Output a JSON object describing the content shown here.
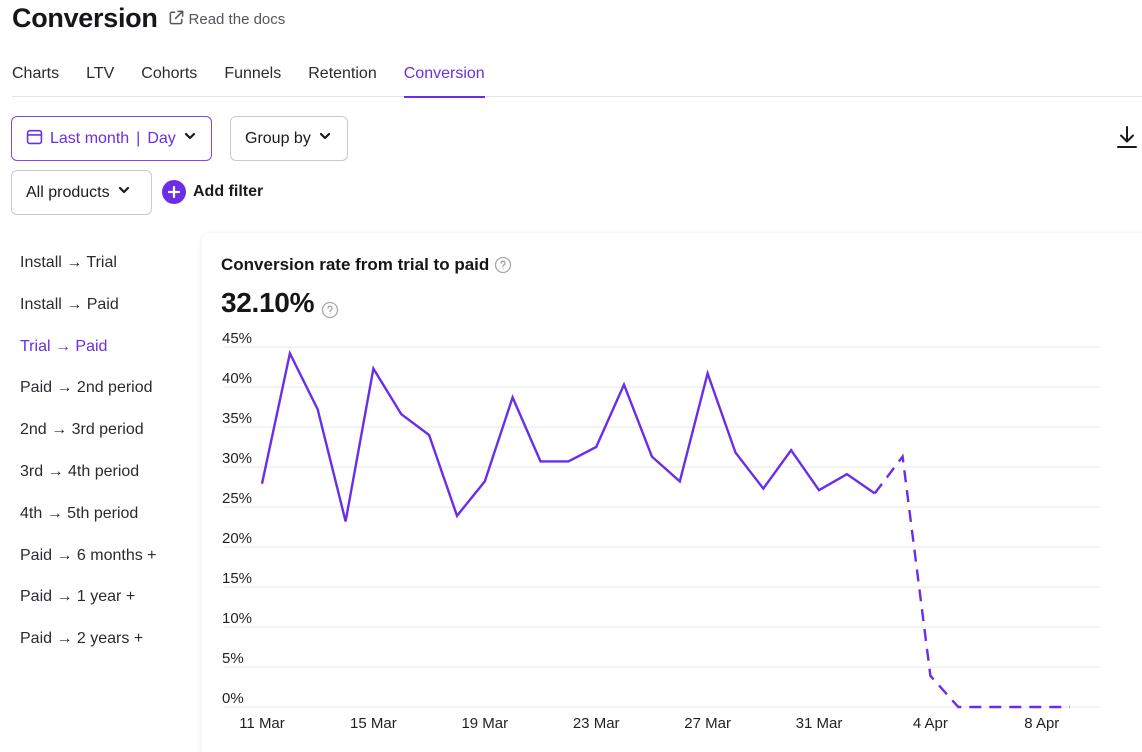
{
  "header": {
    "title": "Conversion",
    "docs_link": "Read the docs"
  },
  "tabs": [
    {
      "label": "Charts"
    },
    {
      "label": "LTV"
    },
    {
      "label": "Cohorts"
    },
    {
      "label": "Funnels"
    },
    {
      "label": "Retention"
    },
    {
      "label": "Conversion",
      "active": true
    }
  ],
  "filters": {
    "period_label": "Last month",
    "granularity_label": "Day",
    "group_by_label": "Group by",
    "products_label": "All products",
    "add_filter_label": "Add filter"
  },
  "metrics": [
    {
      "label": "Install → Trial"
    },
    {
      "label": "Install → Paid"
    },
    {
      "label": "Trial → Paid",
      "active": true
    },
    {
      "label": "Paid → 2nd period"
    },
    {
      "label": "2nd → 3rd period"
    },
    {
      "label": "3rd → 4th period"
    },
    {
      "label": "4th → 5th period"
    },
    {
      "label": "Paid → 6 months +"
    },
    {
      "label": "Paid → 1 year +"
    },
    {
      "label": "Paid → 2 years +"
    }
  ],
  "chart": {
    "title": "Conversion rate from trial to paid",
    "value": "32.10%"
  },
  "colors": {
    "accent": "#6a2ee8",
    "line": "#6a2ee8",
    "grid": "#e6e7eb"
  },
  "chart_data": {
    "type": "line",
    "title": "Conversion rate from trial to paid",
    "xlabel": "",
    "ylabel": "",
    "ylim": [
      0,
      45
    ],
    "yticks": [
      "0%",
      "5%",
      "10%",
      "15%",
      "20%",
      "25%",
      "30%",
      "35%",
      "40%",
      "45%"
    ],
    "x_tick_labels": [
      "11 Mar",
      "15 Mar",
      "19 Mar",
      "23 Mar",
      "27 Mar",
      "31 Mar",
      "4 Apr",
      "8 Apr"
    ],
    "x": [
      "11 Mar",
      "12 Mar",
      "13 Mar",
      "14 Mar",
      "15 Mar",
      "16 Mar",
      "17 Mar",
      "18 Mar",
      "19 Mar",
      "20 Mar",
      "21 Mar",
      "22 Mar",
      "23 Mar",
      "24 Mar",
      "25 Mar",
      "26 Mar",
      "27 Mar",
      "28 Mar",
      "29 Mar",
      "30 Mar",
      "31 Mar",
      "1 Apr",
      "2 Apr",
      "3 Apr",
      "4 Apr",
      "5 Apr",
      "6 Apr",
      "7 Apr",
      "8 Apr",
      "9 Apr"
    ],
    "series": [
      {
        "values": [
          27.9,
          44.2,
          37.2,
          23.2,
          42.3,
          36.6,
          34.0,
          23.9,
          28.2,
          38.7,
          30.7,
          30.7,
          32.5,
          40.3,
          31.3,
          28.2,
          41.7,
          31.8,
          27.3,
          32.1,
          27.1,
          29.1,
          26.7,
          31.3,
          3.9,
          0,
          0,
          0,
          0,
          0
        ],
        "solid_until": "2 Apr",
        "dashed_from": "2 Apr"
      }
    ],
    "grid": true,
    "legend": "none"
  }
}
